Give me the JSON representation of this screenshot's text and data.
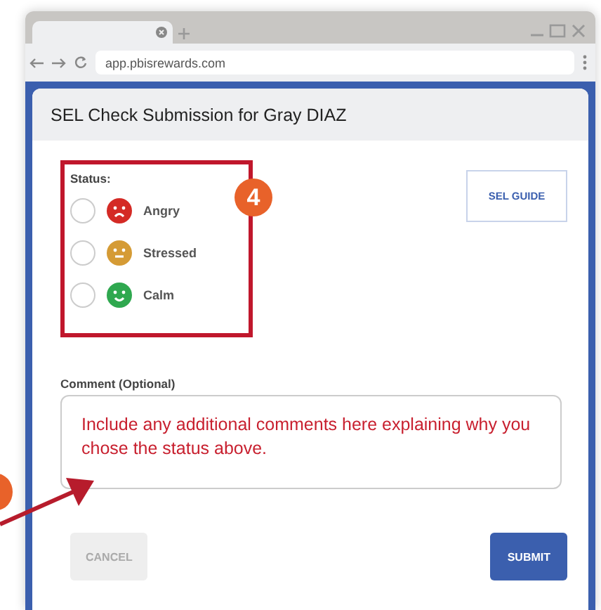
{
  "browser": {
    "url": "app.pbisrewards.com"
  },
  "dialog": {
    "title": "SEL Check Submission for Gray DIAZ",
    "status_label": "Status:",
    "options": [
      {
        "label": "Angry",
        "kind": "angry",
        "color": "#d42a25",
        "selected": false
      },
      {
        "label": "Stressed",
        "kind": "stressed",
        "color": "#d59b35",
        "selected": false
      },
      {
        "label": "Calm",
        "kind": "calm",
        "color": "#2fa84f",
        "selected": false
      }
    ],
    "guide_button": "SEL GUIDE",
    "comment_label": "Comment (Optional)",
    "comment_value": "Include any additional comments here explaining why you chose the status above.",
    "buttons": [
      {
        "label": "CANCEL",
        "kind": "cancel",
        "disabled": true
      },
      {
        "label": "SUBMIT",
        "kind": "submit",
        "disabled": false
      }
    ]
  },
  "annotation": {
    "step": "4"
  }
}
